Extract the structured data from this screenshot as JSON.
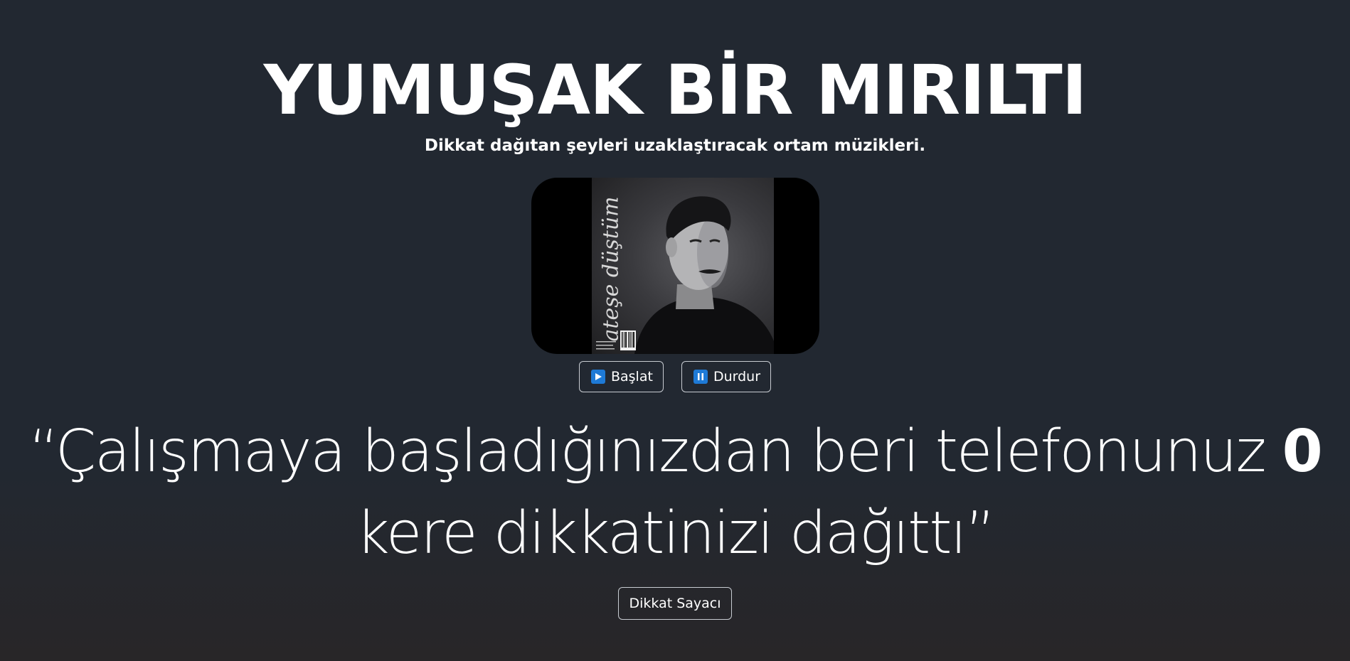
{
  "header": {
    "title": "YUMUŞAK BİR MIRILTI",
    "subtitle": "Dikkat dağıtan şeyleri uzaklaştıracak ortam müzikleri."
  },
  "player": {
    "album_script": "ateşe düştüm",
    "start_label": "Başlat",
    "stop_label": "Durdur",
    "accent_color": "#1e7ad6"
  },
  "quote": {
    "open": "“Çalışmaya başladığınızdan beri telefonunuz ",
    "count": "0",
    "close": " kere dikkatinizi dağıttı”"
  },
  "counter": {
    "button_label": "Dikkat Sayacı"
  }
}
